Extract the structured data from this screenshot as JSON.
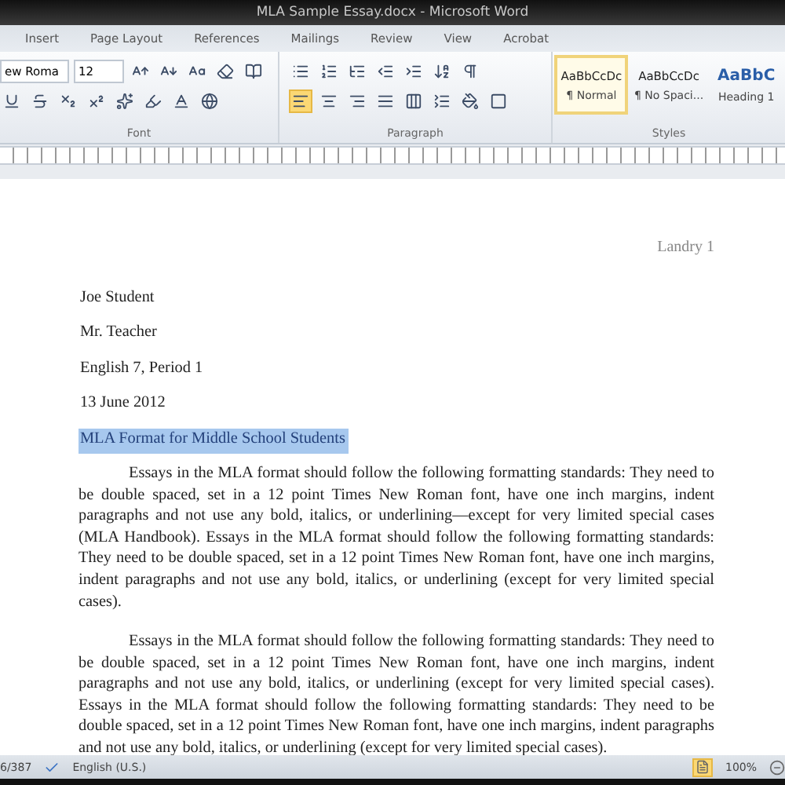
{
  "window": {
    "title": "MLA Sample Essay.docx - Microsoft Word"
  },
  "ribbon_tabs": [
    {
      "label": "Insert"
    },
    {
      "label": "Page Layout"
    },
    {
      "label": "References"
    },
    {
      "label": "Mailings"
    },
    {
      "label": "Review"
    },
    {
      "label": "View"
    },
    {
      "label": "Acrobat"
    }
  ],
  "font_group": {
    "font_name": "ew Roma",
    "font_size": "12",
    "label": "Font"
  },
  "paragraph_group": {
    "label": "Paragraph",
    "alignment": [
      {
        "kind": "left",
        "selected": true
      },
      {
        "kind": "center",
        "selected": false
      },
      {
        "kind": "right",
        "selected": false
      },
      {
        "kind": "justify",
        "selected": false
      },
      {
        "kind": "distributed",
        "selected": false
      }
    ]
  },
  "styles_group": {
    "label": "Styles",
    "styles": [
      {
        "sample": "AaBbCcDc",
        "name": "¶ Normal",
        "kind": "body",
        "selected": true
      },
      {
        "sample": "AaBbCcDc",
        "name": "¶ No Spaci...",
        "kind": "body",
        "selected": false
      },
      {
        "sample": "AaBbC",
        "name": "Heading 1",
        "kind": "heading",
        "selected": false
      }
    ]
  },
  "document": {
    "header": "Landry 1",
    "heading_lines": [
      {
        "text": "Joe Student",
        "selected": false
      },
      {
        "text": "Mr. Teacher",
        "selected": false
      },
      {
        "text": "English 7, Period 1",
        "selected": false
      },
      {
        "text": "13 June 2012",
        "selected": false
      },
      {
        "text": "MLA Format for Middle School Students",
        "selected": true
      }
    ],
    "paragraphs": [
      "Essays in the MLA format should follow the following formatting standards: They need to be double spaced, set in a 12 point Times  New Roman font, have one inch margins,  indent paragraphs and not use any bold, italics, or underlining—except  for very limited special  cases (MLA Handbook). Essays in the MLA format should follow the following formatting standards: They need to be double spaced, set in a 12 point Times  New Roman  font, have one inch margins, indent paragraphs and not use any bold, italics, or underlining (except for very limited  special cases).",
      "Essays in the MLA format should follow the following formatting standards: They need to be double spaced, set in a 12 point Times  New Roman font, have one inch margins,  indent paragraphs and not use any bold, italics, or underlining (except for very limited special cases). Essays in the MLA format should follow the following formatting standards: They need to be double spaced, set in a 12 point Times  New Roman font, have one inch margins,  indent paragraphs and not use any bold, italics, or underlining (except for very limited special cases)."
    ]
  },
  "status_bar": {
    "words": "6/387",
    "language": "English (U.S.)",
    "zoom": "100%"
  }
}
